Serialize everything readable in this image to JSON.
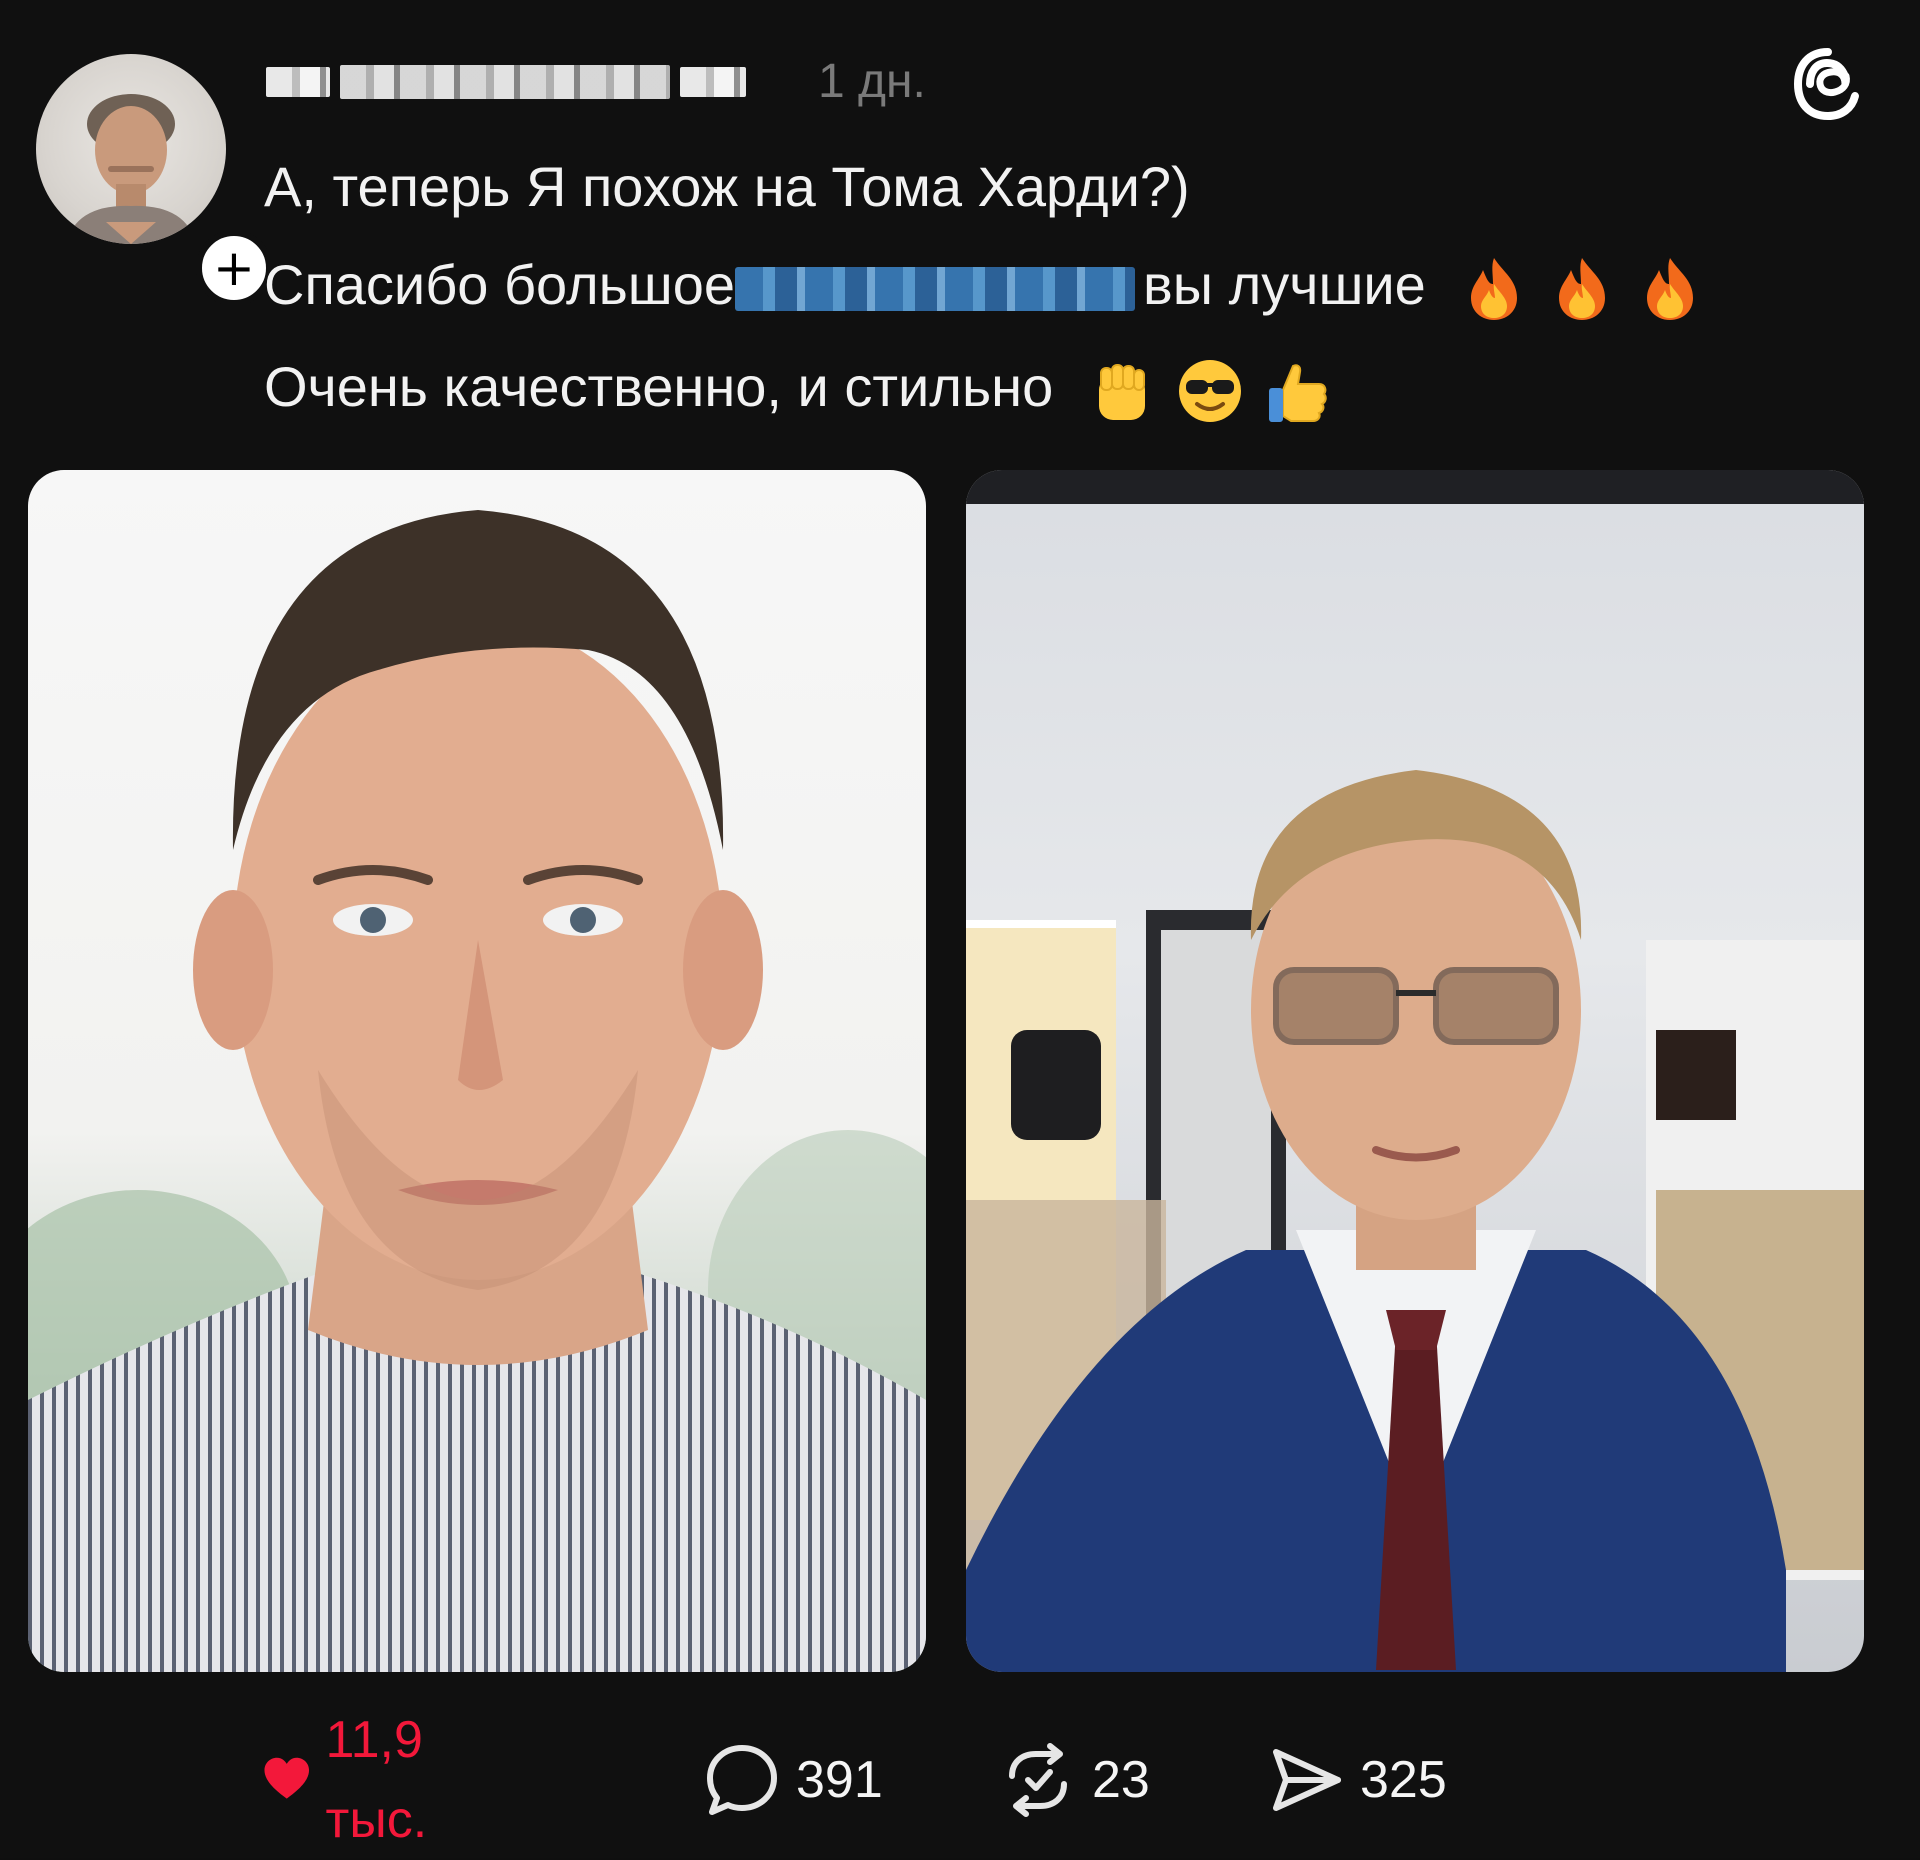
{
  "post": {
    "time_ago": "1 дн.",
    "line1": "А, теперь Я похож на Тома Харди?)",
    "line2_prefix": "Спасибо большое",
    "line2_suffix": "вы лучшие",
    "line3": "Очень качественно, и стильно",
    "line2_emojis": [
      "fire-icon",
      "fire-icon",
      "fire-icon"
    ],
    "line3_emojis": [
      "raised-fist-icon",
      "sunglasses-face-icon",
      "thumbs-up-icon"
    ]
  },
  "actions": {
    "likes": "11,9 тыс.",
    "replies": "391",
    "reposts": "23",
    "shares": "325"
  },
  "colors": {
    "background": "#101010",
    "text": "#f2f2f2",
    "muted": "#7a7a7a",
    "like": "#f3183a"
  }
}
